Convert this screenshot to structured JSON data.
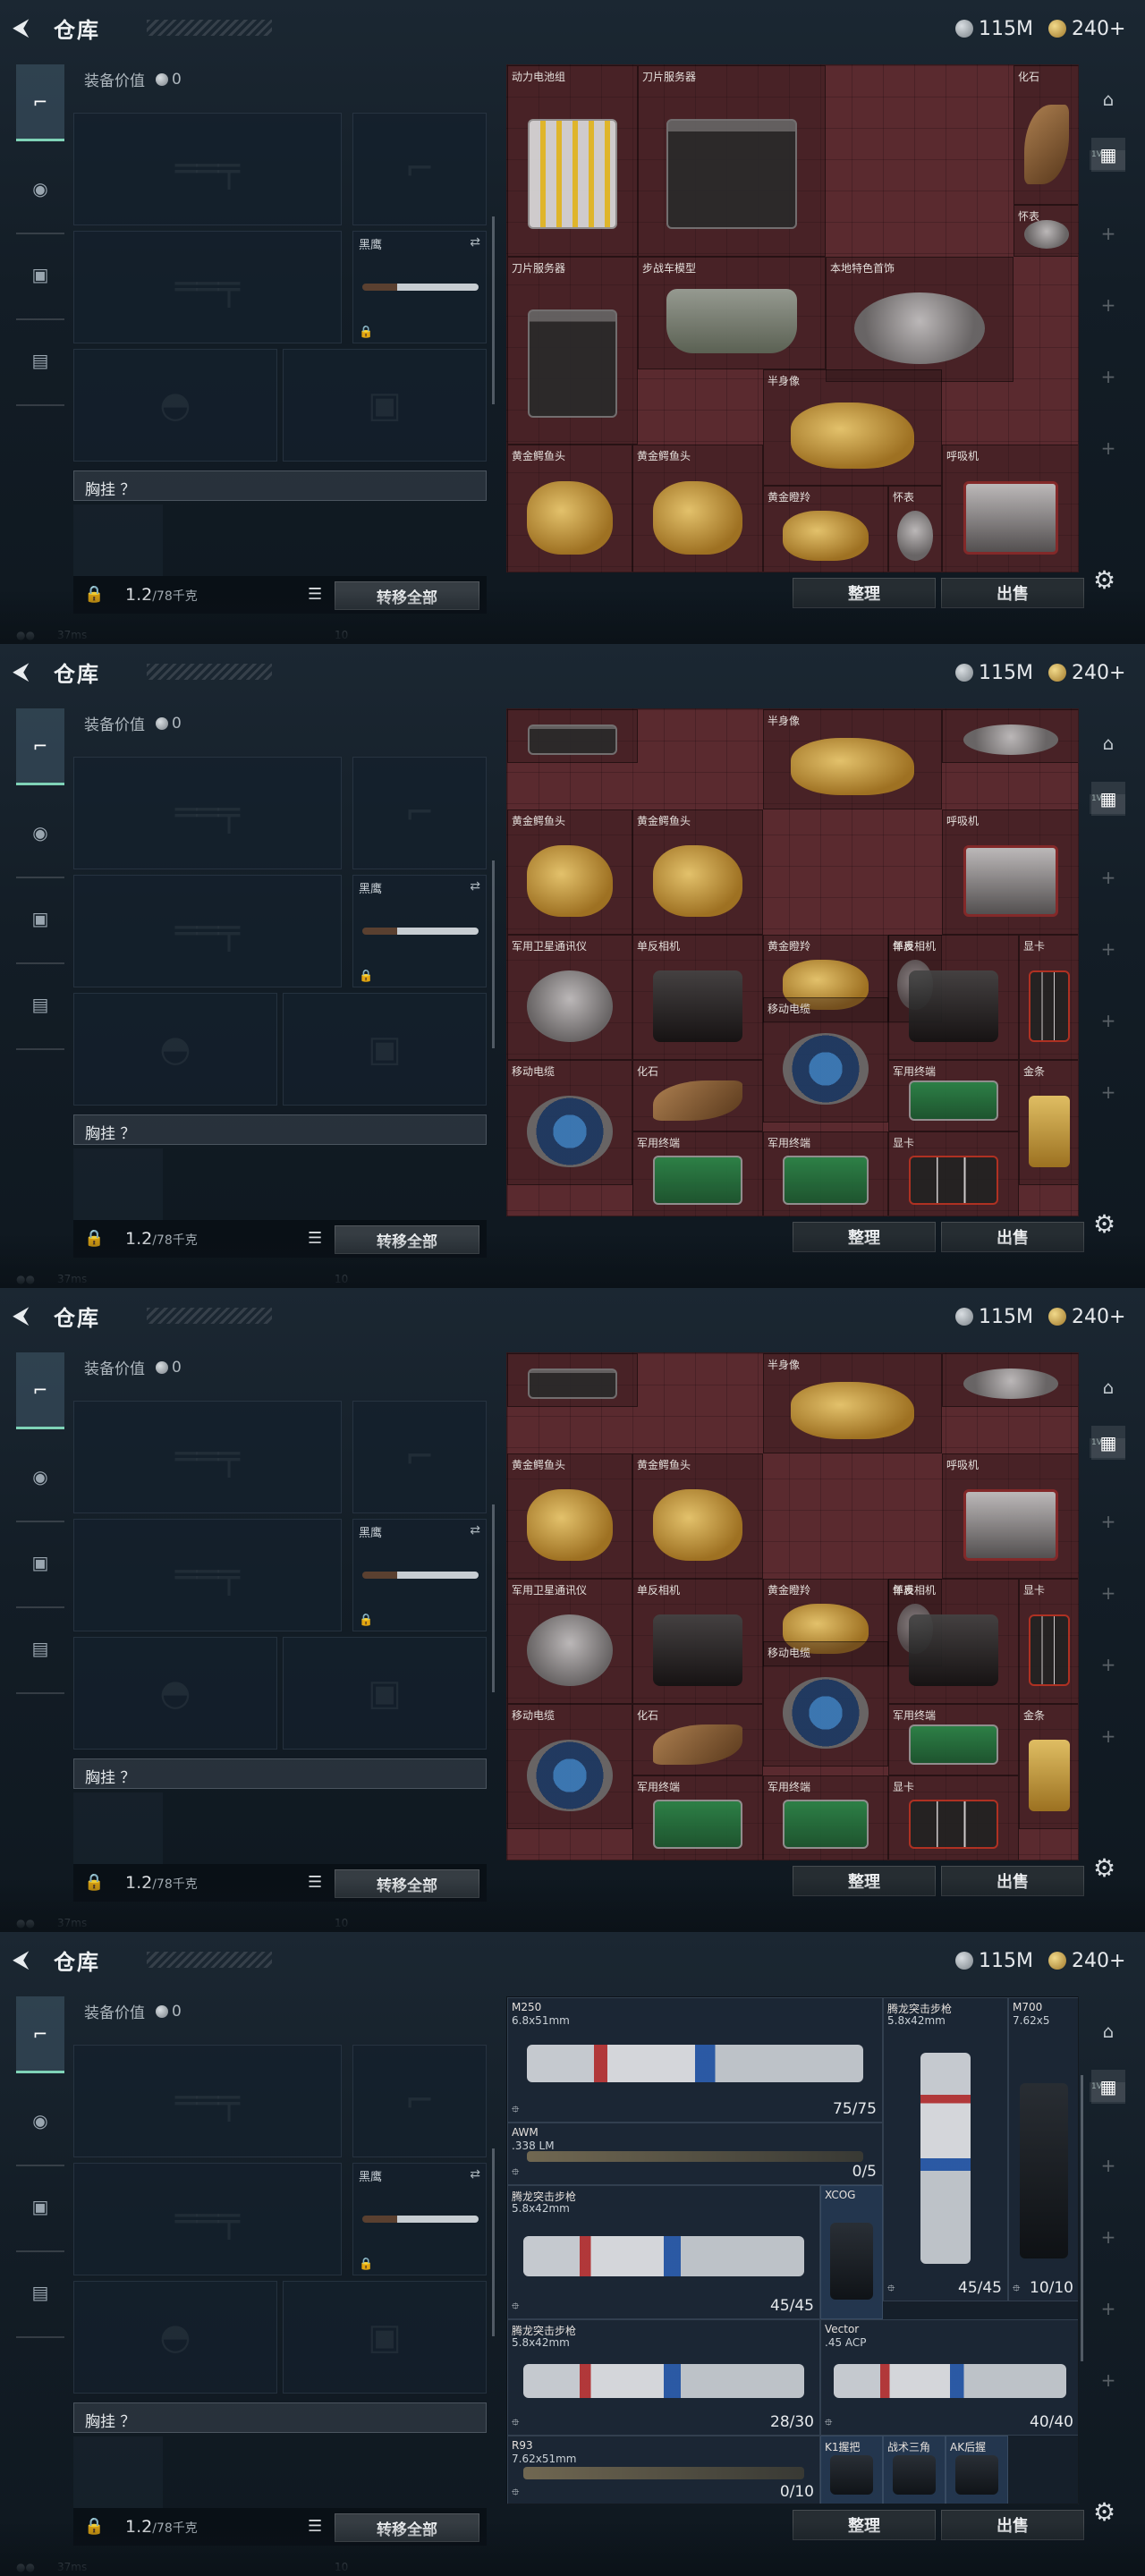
{
  "header": {
    "back_icon": "back-arrow-icon",
    "title": "仓库",
    "silver": "115M",
    "gold": "240+"
  },
  "loadout": {
    "equip_value_label": "装备价值",
    "equip_value": "0",
    "melee_label": "黑鹰",
    "rig_label": "胸挂 ？",
    "weight": "1.2",
    "weight_max": "/78千克",
    "transfer_all": "转移全部"
  },
  "actions": {
    "sort": "整理",
    "sell": "出售"
  },
  "status": {
    "ping": "37ms",
    "number": "10"
  },
  "rail_thumb_label": "1V",
  "frames": [
    {
      "kind": "items",
      "items": [
        {
          "name": "动力电池组",
          "art": "art-battery"
        },
        {
          "name": "刀片服务器",
          "art": "art-server"
        },
        {
          "name": "化石",
          "art": "art-fossil"
        },
        {
          "name": "怀表",
          "art": "art-silver"
        },
        {
          "name": "刀片服务器",
          "art": "art-server"
        },
        {
          "name": "步战车模型",
          "art": "art-tank"
        },
        {
          "name": "本地特色首饰",
          "art": "art-silver"
        },
        {
          "name": "半身像",
          "art": "art-gold"
        },
        {
          "name": "黄金鳄鱼头",
          "art": "art-gold"
        },
        {
          "name": "黄金鳄鱼头",
          "art": "art-gold"
        },
        {
          "name": "呼吸机",
          "art": "art-device"
        },
        {
          "name": "黄金瞪羚",
          "art": "art-gold"
        },
        {
          "name": "怀表",
          "art": "art-silver"
        }
      ]
    },
    {
      "kind": "items",
      "items": [
        {
          "name": "",
          "art": "art-server"
        },
        {
          "name": "半身像",
          "art": "art-gold"
        },
        {
          "name": "",
          "art": "art-silver"
        },
        {
          "name": "黄金鳄鱼头",
          "art": "art-gold"
        },
        {
          "name": "黄金鳄鱼头",
          "art": "art-gold"
        },
        {
          "name": "呼吸机",
          "art": "art-device"
        },
        {
          "name": "黄金瞪羚",
          "art": "art-gold"
        },
        {
          "name": "怀表",
          "art": "art-silver"
        },
        {
          "name": "军用卫星通讯仪",
          "art": "art-silver"
        },
        {
          "name": "单反相机",
          "art": "art-camera"
        },
        {
          "name": "单反相机",
          "art": "art-camera"
        },
        {
          "name": "显卡",
          "art": "art-gpu"
        },
        {
          "name": "移动电缆",
          "art": "art-reel"
        },
        {
          "name": "移动电缆",
          "art": "art-reel"
        },
        {
          "name": "化石",
          "art": "art-fossil"
        },
        {
          "name": "军用终端",
          "art": "art-board"
        },
        {
          "name": "金条",
          "art": "art-goldbar"
        },
        {
          "name": "军用终端",
          "art": "art-board"
        },
        {
          "name": "军用终端",
          "art": "art-board"
        },
        {
          "name": "显卡",
          "art": "art-gpu"
        }
      ]
    },
    {
      "kind": "items",
      "items": [
        {
          "name": "",
          "art": "art-server"
        },
        {
          "name": "半身像",
          "art": "art-gold"
        },
        {
          "name": "",
          "art": "art-silver"
        },
        {
          "name": "黄金鳄鱼头",
          "art": "art-gold"
        },
        {
          "name": "黄金鳄鱼头",
          "art": "art-gold"
        },
        {
          "name": "呼吸机",
          "art": "art-device"
        },
        {
          "name": "黄金瞪羚",
          "art": "art-gold"
        },
        {
          "name": "怀表",
          "art": "art-silver"
        },
        {
          "name": "军用卫星通讯仪",
          "art": "art-silver"
        },
        {
          "name": "单反相机",
          "art": "art-camera"
        },
        {
          "name": "单反相机",
          "art": "art-camera"
        },
        {
          "name": "显卡",
          "art": "art-gpu"
        },
        {
          "name": "移动电缆",
          "art": "art-reel"
        },
        {
          "name": "移动电缆",
          "art": "art-reel"
        },
        {
          "name": "化石",
          "art": "art-fossil"
        },
        {
          "name": "军用终端",
          "art": "art-board"
        },
        {
          "name": "金条",
          "art": "art-goldbar"
        },
        {
          "name": "军用终端",
          "art": "art-board"
        },
        {
          "name": "军用终端",
          "art": "art-board"
        },
        {
          "name": "显卡",
          "art": "art-gpu"
        }
      ]
    },
    {
      "kind": "weapons",
      "items": [
        {
          "name": "M250",
          "sub": "6.8x51mm",
          "ammo": "75/75",
          "art": "art-rifle"
        },
        {
          "name": "腾龙突击步枪",
          "sub": "5.8x42mm",
          "ammo": "45/45",
          "art": "art-rifle-v"
        },
        {
          "name": "M700",
          "sub": "7.62x5",
          "ammo": "10/10",
          "art": "art-dark"
        },
        {
          "name": "AWM",
          "sub": ".338 LM",
          "ammo": "0/5",
          "art": "art-sniper"
        },
        {
          "name": "腾龙突击步枪",
          "sub": "5.8x42mm",
          "ammo": "45/45",
          "art": "art-rifle"
        },
        {
          "name": "XCOG",
          "sub": "",
          "ammo": "",
          "art": "art-dark"
        },
        {
          "name": "腾龙突击步枪",
          "sub": "5.8x42mm",
          "ammo": "28/30",
          "art": "art-rifle"
        },
        {
          "name": "Vector",
          "sub": ".45 ACP",
          "ammo": "40/40",
          "art": "art-rifle"
        },
        {
          "name": "R93",
          "sub": "7.62x51mm",
          "ammo": "0/10",
          "art": "art-sniper"
        },
        {
          "name": "K1握把",
          "sub": "",
          "ammo": "",
          "art": "art-dark"
        },
        {
          "name": "战术三角",
          "sub": "",
          "ammo": "",
          "art": "art-dark"
        },
        {
          "name": "AK后握",
          "sub": "",
          "ammo": "",
          "art": "art-dark"
        }
      ]
    }
  ]
}
